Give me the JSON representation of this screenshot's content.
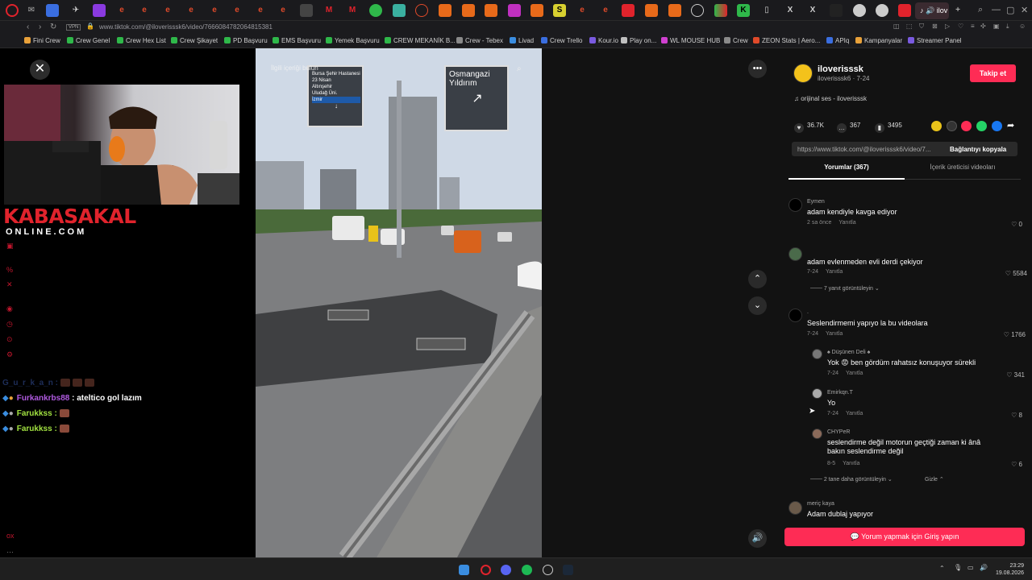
{
  "browser": {
    "url": "www.tiktok.com/@iloverisssk6/video/7666084782064815381",
    "vpn_label": "VPN",
    "active_tab_label": "ilov",
    "bookmarks": [
      {
        "label": "Fini Crew",
        "color": "#e8a13a"
      },
      {
        "label": "Crew Genel",
        "color": "#2fb84a"
      },
      {
        "label": "Crew Hex List",
        "color": "#2fb84a"
      },
      {
        "label": "Crew Şikayet",
        "color": "#2fb84a"
      },
      {
        "label": "PD Başvuru",
        "color": "#2fb84a"
      },
      {
        "label": "EMS Başvuru",
        "color": "#2fb84a"
      },
      {
        "label": "Yemek Başvuru",
        "color": "#2fb84a"
      },
      {
        "label": "CREW MEKANİK B...",
        "color": "#2fb84a"
      },
      {
        "label": "Crew - Tebex",
        "color": "#8a8a8a"
      },
      {
        "label": "Livad",
        "color": "#3a8de0"
      },
      {
        "label": "Crew Trello",
        "color": "#3a6ee0"
      },
      {
        "label": "Kour.io",
        "color": "#7a5ae0"
      },
      {
        "label": "Play on...",
        "color": "#c0c0c0"
      },
      {
        "label": "WL MOUSE HUB",
        "color": "#d040d0"
      },
      {
        "label": "Crew",
        "color": "#8a8a8a"
      },
      {
        "label": "ZEON Stats | Aero...",
        "color": "#e04a2a"
      },
      {
        "label": "APIq",
        "color": "#3a6ee0"
      },
      {
        "label": "Kampanyalar",
        "color": "#e8a13a"
      },
      {
        "label": "Streamer Panel",
        "color": "#7a5ae0"
      }
    ]
  },
  "stream": {
    "logo_main": "KABASAKAL",
    "logo_sub": "ONLINE.COM",
    "chat": [
      {
        "user": "G_u_r_k_a_n :",
        "message": "",
        "user_color": "#3a5ab0",
        "faded": true
      },
      {
        "user": "Furkankrbs88",
        "message": ": ateltico gol lazım",
        "user_color": "#b05ae0",
        "faded": false
      },
      {
        "user": "Farukkss :",
        "message": "",
        "user_color": "#a0e040",
        "faded": false
      },
      {
        "user": "Farukkss :",
        "message": "",
        "user_color": "#a0e040",
        "faded": false
      }
    ]
  },
  "video": {
    "search_placeholder": "İlgili içeriği bulun",
    "sign_left": [
      "Bursa Şehir Hastanesi",
      "23 Nisan",
      "Altınşehir",
      "Uludağ Üni.",
      "İzmir"
    ],
    "sign_right": [
      "Osmangazi",
      "Yıldırım"
    ]
  },
  "post": {
    "username": "iloverisssk",
    "handle": "iloverisssk6 · 7-24",
    "follow_label": "Takip et",
    "sound": "orijinal ses - iloverisssk",
    "likes": "36.7K",
    "comments": "367",
    "saves": "3495",
    "link": "https://www.tiktok.com/@iloverisssk6/video/7...",
    "copy_label": "Bağlantıyı kopyala",
    "tab_comments": "Yorumlar (367)",
    "tab_creator": "İçerik üreticisi videoları",
    "login_label": "Yorum yapmak için Giriş yapın"
  },
  "comments": [
    {
      "name": "Eymen",
      "text": "adam kendiyle kavga ediyor",
      "time": "2 sa önce",
      "reply": "Yanıtla",
      "likes": "0"
    },
    {
      "name": "",
      "text": "adam evlenmeden evli derdi çekiyor",
      "time": "7-24",
      "reply": "Yanıtla",
      "likes": "5584",
      "more": "7 yanıt görüntüleyin"
    },
    {
      "name": ".",
      "text": "Seslendirmemi yapıyo la bu videolara",
      "time": "7-24",
      "reply": "Yanıtla",
      "likes": "1766"
    }
  ],
  "replies": [
    {
      "name": "Düşünen Deli",
      "text": "Yok 😡 ben gördüm rahatsız konuşuyor sürekli",
      "time": "7-24",
      "reply": "Yanıtla",
      "likes": "341"
    },
    {
      "name": "Emirkqn.T",
      "text": "Yo",
      "time": "7-24",
      "reply": "Yanıtla",
      "likes": "8"
    },
    {
      "name": "CHYPeR",
      "text": "seslendirme değil motorun geçtiği zaman ki ânâ bakın seslendirme değil",
      "time": "8-5",
      "reply": "Yanıtla",
      "likes": "6"
    }
  ],
  "more_replies": "2 tane daha görüntüleyin",
  "hide_label": "Gizle",
  "last_comment": {
    "name": "meriç kaya",
    "text": "Adam dublaj yapıyor"
  },
  "taskbar": {
    "time": "23:29",
    "date": "19.08.2026"
  }
}
